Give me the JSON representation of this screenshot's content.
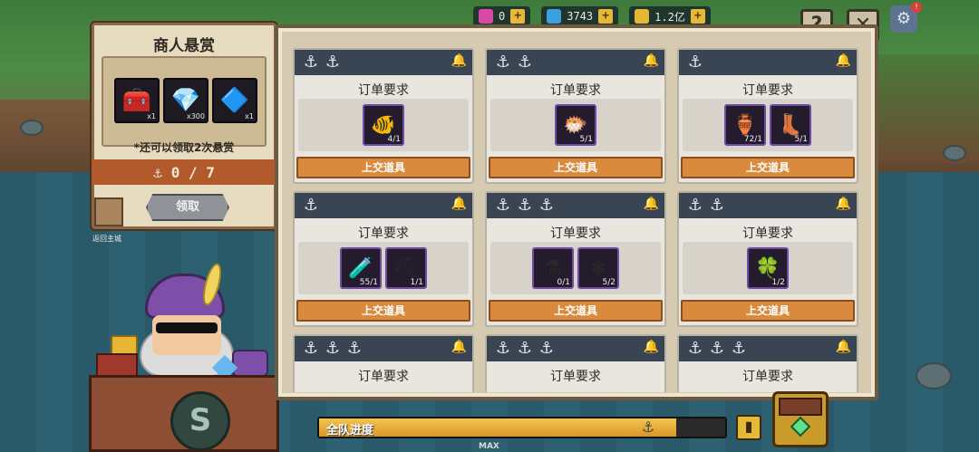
{
  "top_bar": {
    "resources": [
      {
        "name": "pink-gem",
        "value": "0",
        "color": "#d84aa8"
      },
      {
        "name": "blue-gem",
        "value": "3743",
        "color": "#3aa0e0"
      },
      {
        "name": "gold-coin",
        "value": "1.2亿",
        "color": "#e6b735"
      }
    ]
  },
  "buttons": {
    "help": "?",
    "close": "✕"
  },
  "reward_panel": {
    "title": "商人悬赏",
    "items": [
      {
        "icon": "treasure-chest-icon",
        "glyph": "🧰",
        "qty": "x1"
      },
      {
        "icon": "diamond-icon",
        "glyph": "💎",
        "qty": "x300"
      },
      {
        "icon": "crystal-icon",
        "glyph": "🔷",
        "qty": "x1"
      }
    ],
    "note": "*还可以领取2次悬赏",
    "progress_text": "0 / 7",
    "claim_label": "领取",
    "back_label": "返回主城"
  },
  "orders": {
    "label": "订单要求",
    "submit_label": "上交道具",
    "cards": [
      {
        "anchors": 2,
        "items": [
          {
            "icon": "goldfish-icon",
            "glyph": "🐠",
            "count": "4/1"
          }
        ]
      },
      {
        "anchors": 2,
        "items": [
          {
            "icon": "pufferfish-icon",
            "glyph": "🐡",
            "count": "5/1"
          }
        ]
      },
      {
        "anchors": 1,
        "items": [
          {
            "icon": "vase-icon",
            "glyph": "🏺",
            "count": "72/1"
          },
          {
            "icon": "boot-icon",
            "glyph": "👢",
            "count": "5/1"
          }
        ]
      },
      {
        "anchors": 1,
        "items": [
          {
            "icon": "potion-icon",
            "glyph": "🧪",
            "count": "55/1"
          },
          {
            "icon": "ore-icon",
            "glyph": "⛏",
            "count": "1/1"
          }
        ]
      },
      {
        "anchors": 3,
        "items": [
          {
            "icon": "blue-potion-icon",
            "glyph": "⚗",
            "count": "0/1"
          },
          {
            "icon": "ice-crystal-icon",
            "glyph": "❄",
            "count": "5/2"
          }
        ]
      },
      {
        "anchors": 2,
        "items": [
          {
            "icon": "clover-icon",
            "glyph": "🍀",
            "count": "1/2"
          }
        ]
      },
      {
        "anchors": 3,
        "items": []
      },
      {
        "anchors": 3,
        "items": []
      },
      {
        "anchors": 3,
        "items": []
      }
    ]
  },
  "team_progress": {
    "label": "全队进度",
    "count": "44/50",
    "current": 44,
    "total": 50,
    "max_label": "MAX"
  },
  "colors": {
    "accent_orange": "#d98a3d",
    "header_slate": "#394552",
    "board_beige": "#d6cbb0"
  }
}
